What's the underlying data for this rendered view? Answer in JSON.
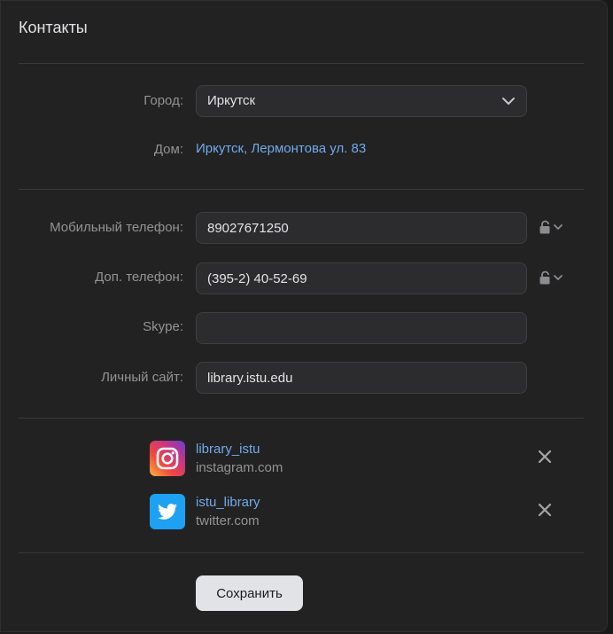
{
  "page": {
    "title": "Контакты"
  },
  "city": {
    "label": "Город:",
    "value": "Иркутск"
  },
  "home": {
    "label": "Дом:",
    "value": "Иркутск, Лермонтова ул. 83"
  },
  "mobile": {
    "label": "Мобильный телефон:",
    "value": "89027671250"
  },
  "extra_phone": {
    "label": "Доп. телефон:",
    "value": "(395-2) 40-52-69"
  },
  "skype": {
    "label": "Skype:",
    "value": ""
  },
  "website": {
    "label": "Личный сайт:",
    "value": "library.istu.edu"
  },
  "social": [
    {
      "name": "library_istu",
      "domain": "instagram.com",
      "icon": "instagram-icon"
    },
    {
      "name": "istu_library",
      "domain": "twitter.com",
      "icon": "twitter-icon"
    }
  ],
  "actions": {
    "save_label": "Сохранить"
  },
  "colors": {
    "accent_link": "#71aaeb",
    "background": "#222222",
    "muted_text": "#939393"
  }
}
